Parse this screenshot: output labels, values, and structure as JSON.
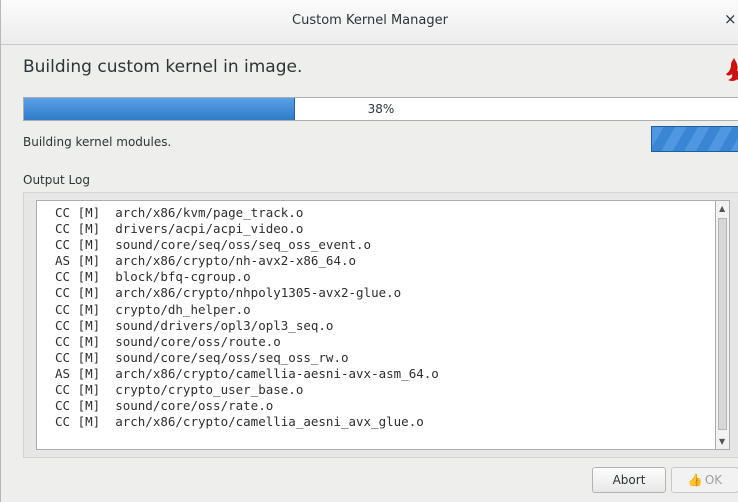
{
  "window": {
    "title": "Custom Kernel Manager",
    "close_glyph": "×"
  },
  "heading": "Building custom kernel in image.",
  "logo_icon": "flame-logo",
  "progress": {
    "value": 0.38,
    "label": "38%"
  },
  "status": "Building kernel modules.",
  "log": {
    "label": "Output Log",
    "lines": [
      "CC [M]  arch/x86/kvm/page_track.o",
      "CC [M]  drivers/acpi/acpi_video.o",
      "CC [M]  sound/core/seq/oss/seq_oss_event.o",
      "AS [M]  arch/x86/crypto/nh-avx2-x86_64.o",
      "CC [M]  block/bfq-cgroup.o",
      "CC [M]  arch/x86/crypto/nhpoly1305-avx2-glue.o",
      "CC [M]  crypto/dh_helper.o",
      "CC [M]  sound/drivers/opl3/opl3_seq.o",
      "CC [M]  sound/core/oss/route.o",
      "CC [M]  sound/core/seq/oss/seq_oss_rw.o",
      "AS [M]  arch/x86/crypto/camellia-aesni-avx-asm_64.o",
      "CC [M]  crypto/crypto_user_base.o",
      "CC [M]  sound/core/oss/rate.o",
      "CC [M]  arch/x86/crypto/camellia_aesni_avx_glue.o"
    ]
  },
  "buttons": {
    "abort": "Abort",
    "ok": "OK"
  },
  "colors": {
    "accent": "#3a86d4",
    "logo": "#cc1111"
  }
}
